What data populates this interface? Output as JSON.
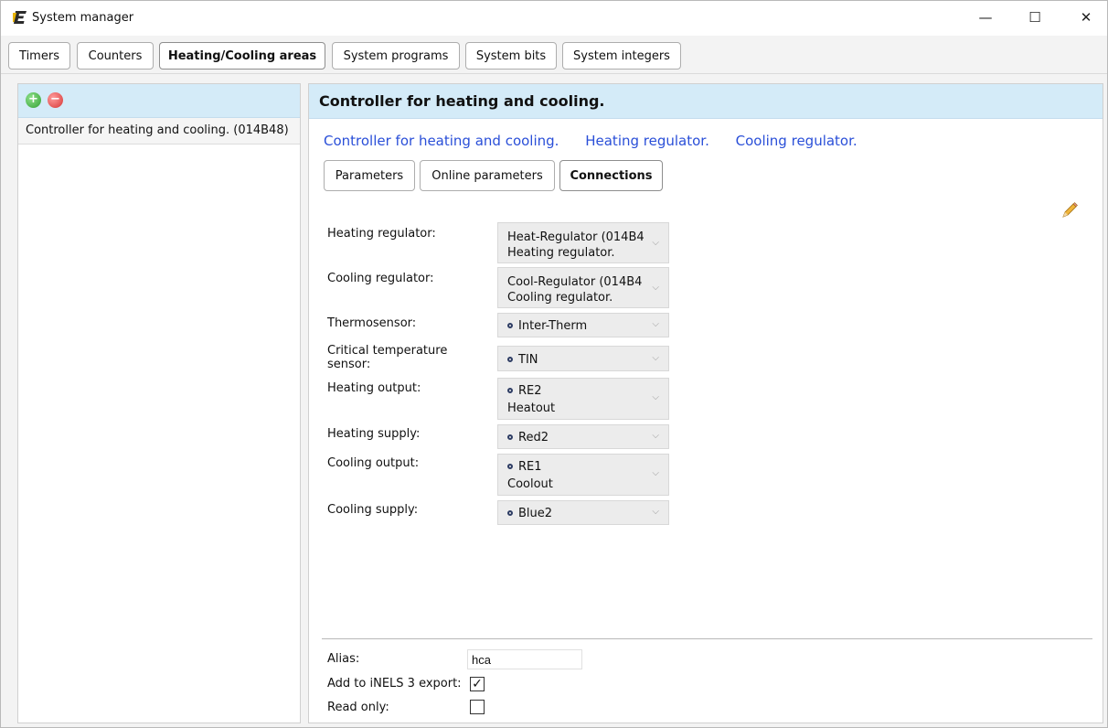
{
  "window": {
    "title": "System manager",
    "controls": {
      "minimize": "—",
      "maximize": "☐",
      "close": "✕"
    }
  },
  "top_tabs": [
    {
      "label": "Timers",
      "active": false
    },
    {
      "label": "Counters",
      "active": false
    },
    {
      "label": "Heating/Cooling areas",
      "active": true
    },
    {
      "label": "System programs",
      "active": false
    },
    {
      "label": "System bits",
      "active": false
    },
    {
      "label": "System integers",
      "active": false
    }
  ],
  "left_panel": {
    "add_icon": "add-circle-icon",
    "remove_icon": "remove-circle-icon",
    "items": [
      "Controller for heating and cooling. (014B48)"
    ]
  },
  "right_panel": {
    "header_title": "Controller for heating and cooling.",
    "links": [
      "Controller for heating and cooling.",
      "Heating regulator.",
      "Cooling regulator."
    ],
    "sub_tabs": [
      {
        "label": "Parameters",
        "active": false
      },
      {
        "label": "Online parameters",
        "active": false
      },
      {
        "label": "Connections",
        "active": true
      }
    ],
    "edit_icon": "pencil-icon",
    "fields": [
      {
        "label": "Heating regulator:",
        "value": "Heat-Regulator (014B4",
        "value2": "Heating regulator.",
        "dot": false
      },
      {
        "label": "Cooling regulator:",
        "value": "Cool-Regulator (014B4",
        "value2": "Cooling regulator.",
        "dot": false
      },
      {
        "label": "Thermosensor:",
        "value": "Inter-Therm",
        "value2": "",
        "dot": true
      },
      {
        "label": "Critical temperature sensor:",
        "value": "TIN",
        "value2": "",
        "dot": true
      },
      {
        "label": "Heating output:",
        "value": "RE2",
        "value2": "Heatout",
        "dot": true
      },
      {
        "label": "Heating supply:",
        "value": "Red2",
        "value2": "",
        "dot": true
      },
      {
        "label": "Cooling output:",
        "value": "RE1",
        "value2": "Coolout",
        "dot": true
      },
      {
        "label": "Cooling supply:",
        "value": "Blue2",
        "value2": "",
        "dot": true
      }
    ],
    "bottom": {
      "alias_label": "Alias:",
      "alias_value": "hca",
      "export_label": "Add to iNELS 3 export:",
      "export_checked": true,
      "readonly_label": "Read only:",
      "readonly_checked": false
    }
  },
  "colors": {
    "header_bg": "#d4ebf8",
    "link": "#2a4fd8"
  }
}
